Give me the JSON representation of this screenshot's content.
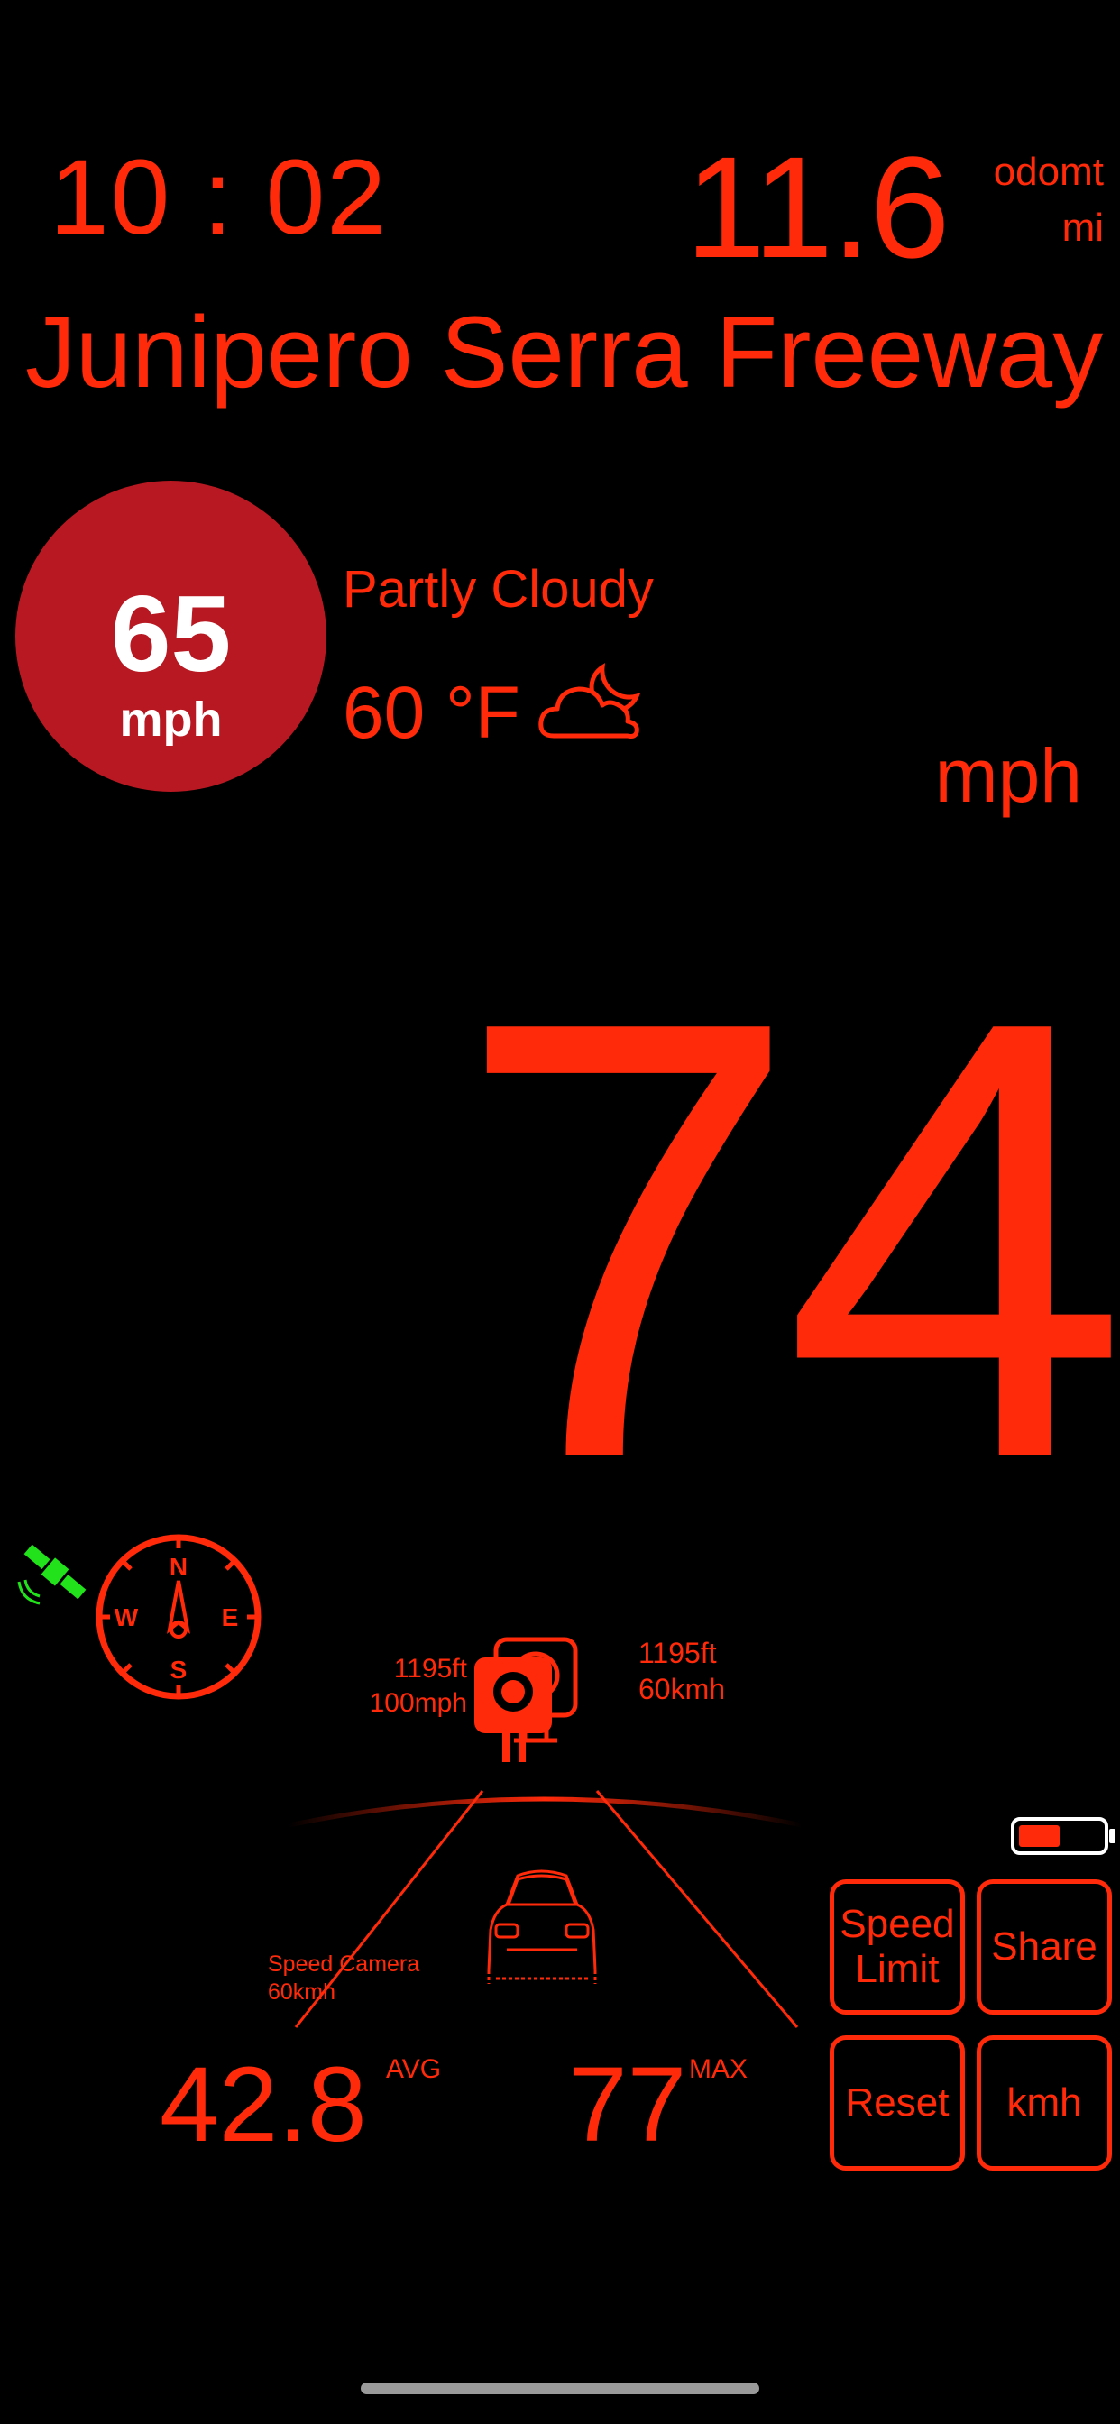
{
  "colors": {
    "accent": "#ff2a0a",
    "limit_sign": "#b81821",
    "gps": "#21e21b",
    "background": "#000000"
  },
  "clock": "10 : 02",
  "odometer": {
    "value": "11.6",
    "label": "odomt",
    "unit": "mi"
  },
  "street": "Junipero Serra Freeway",
  "speed_limit": {
    "value": "65",
    "unit": "mph"
  },
  "weather": {
    "condition": "Partly Cloudy",
    "temperature": "60 °F",
    "icon": "partly-cloudy-night-icon"
  },
  "speed": {
    "value": "74",
    "unit": "mph"
  },
  "gps_icon": "satellite-icon",
  "compass": {
    "n": "N",
    "s": "S",
    "e": "E",
    "w": "W"
  },
  "cameras": {
    "left": {
      "distance": "1195ft",
      "limit": "100mph"
    },
    "right": {
      "distance": "1195ft",
      "limit": "60kmh"
    },
    "bottom": {
      "type": "Speed Camera",
      "limit": "60kmh"
    }
  },
  "stats": {
    "avg_value": "42.8",
    "avg_label": "AVG",
    "max_value": "77",
    "max_label": "MAX"
  },
  "buttons": {
    "speed_limit": "Speed Limit",
    "share": "Share",
    "reset": "Reset",
    "kmh": "kmh"
  },
  "battery": {
    "level": 0.5
  }
}
